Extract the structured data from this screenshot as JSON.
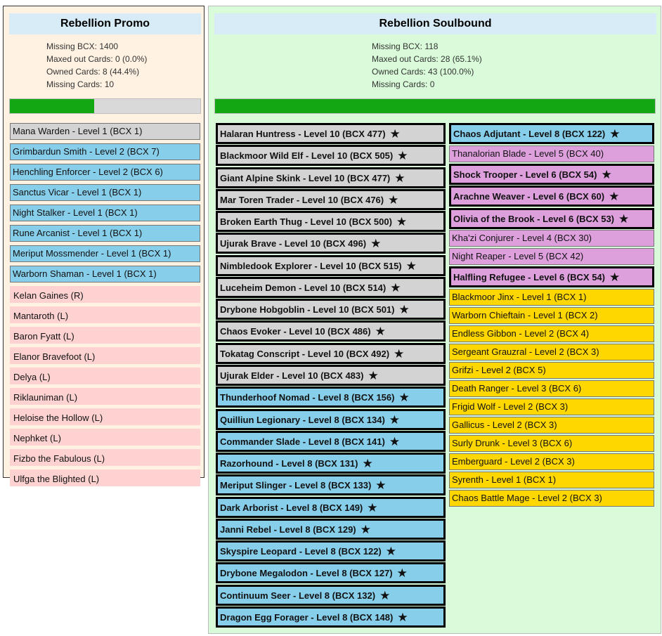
{
  "promo": {
    "title": "Rebellion Promo",
    "stats": [
      "Missing BCX: 1400",
      "Maxed out Cards: 0 (0.0%)",
      "Owned Cards: 8 (44.4%)",
      "Missing Cards: 10"
    ],
    "progress_fraction": 0.444,
    "cards": [
      {
        "label": "Mana Warden - Level 1 (BCX 1)",
        "color": "gray",
        "state": "owned"
      },
      {
        "label": "Grimbardun Smith - Level 2 (BCX 7)",
        "color": "blue",
        "state": "owned"
      },
      {
        "label": "Henchling Enforcer - Level 2 (BCX 6)",
        "color": "blue",
        "state": "owned"
      },
      {
        "label": "Sanctus Vicar - Level 1 (BCX 1)",
        "color": "blue",
        "state": "owned"
      },
      {
        "label": "Night Stalker - Level 1 (BCX 1)",
        "color": "blue",
        "state": "owned"
      },
      {
        "label": "Rune Arcanist - Level 1 (BCX 1)",
        "color": "blue",
        "state": "owned"
      },
      {
        "label": "Meriput Mossmender - Level 1 (BCX 1)",
        "color": "blue",
        "state": "owned"
      },
      {
        "label": "Warborn Shaman - Level 1 (BCX 1)",
        "color": "blue",
        "state": "owned"
      },
      {
        "label": "Kelan Gaines (R)",
        "color": "pink",
        "state": "missing"
      },
      {
        "label": "Mantaroth (L)",
        "color": "pink",
        "state": "missing"
      },
      {
        "label": "Baron Fyatt (L)",
        "color": "pink",
        "state": "missing"
      },
      {
        "label": "Elanor Bravefoot (L)",
        "color": "pink",
        "state": "missing"
      },
      {
        "label": "Delya (L)",
        "color": "pink",
        "state": "missing"
      },
      {
        "label": "Riklauniman (L)",
        "color": "pink",
        "state": "missing"
      },
      {
        "label": "Heloise the Hollow (L)",
        "color": "pink",
        "state": "missing"
      },
      {
        "label": "Nephket (L)",
        "color": "pink",
        "state": "missing"
      },
      {
        "label": "Fizbo the Fabulous (L)",
        "color": "pink",
        "state": "missing"
      },
      {
        "label": "Ulfga the Blighted (L)",
        "color": "pink",
        "state": "missing"
      }
    ]
  },
  "soulbound": {
    "title": "Rebellion Soulbound",
    "stats": [
      "Missing BCX: 118",
      "Maxed out Cards: 28 (65.1%)",
      "Owned Cards: 43 (100.0%)",
      "Missing Cards: 0"
    ],
    "progress_fraction": 1.0,
    "left_cards": [
      {
        "label": "Halaran Huntress - Level 10 (BCX 477)",
        "color": "gray",
        "maxed": true
      },
      {
        "label": "Blackmoor Wild Elf - Level 10 (BCX 505)",
        "color": "gray",
        "maxed": true
      },
      {
        "label": "Giant Alpine Skink - Level 10 (BCX 477)",
        "color": "gray",
        "maxed": true
      },
      {
        "label": "Mar Toren Trader - Level 10 (BCX 476)",
        "color": "gray",
        "maxed": true
      },
      {
        "label": "Broken Earth Thug - Level 10 (BCX 500)",
        "color": "gray",
        "maxed": true
      },
      {
        "label": "Ujurak Brave - Level 10 (BCX 496)",
        "color": "gray",
        "maxed": true
      },
      {
        "label": "Nimbledook Explorer - Level 10 (BCX 515)",
        "color": "gray",
        "maxed": true
      },
      {
        "label": "Luceheim Demon - Level 10 (BCX 514)",
        "color": "gray",
        "maxed": true
      },
      {
        "label": "Drybone Hobgoblin - Level 10 (BCX 501)",
        "color": "gray",
        "maxed": true
      },
      {
        "label": "Chaos Evoker - Level 10 (BCX 486)",
        "color": "gray",
        "maxed": true
      },
      {
        "label": "Tokatag Conscript - Level 10 (BCX 492)",
        "color": "gray",
        "maxed": true
      },
      {
        "label": "Ujurak Elder - Level 10 (BCX 483)",
        "color": "gray",
        "maxed": true
      },
      {
        "label": "Thunderhoof Nomad - Level 8 (BCX 156)",
        "color": "blue",
        "maxed": true
      },
      {
        "label": "Quilliun Legionary - Level 8 (BCX 134)",
        "color": "blue",
        "maxed": true
      },
      {
        "label": "Commander Slade - Level 8 (BCX 141)",
        "color": "blue",
        "maxed": true
      },
      {
        "label": "Razorhound - Level 8 (BCX 131)",
        "color": "blue",
        "maxed": true
      },
      {
        "label": "Meriput Slinger - Level 8 (BCX 133)",
        "color": "blue",
        "maxed": true
      },
      {
        "label": "Dark Arborist - Level 8 (BCX 149)",
        "color": "blue",
        "maxed": true
      },
      {
        "label": "Janni Rebel - Level 8 (BCX 129)",
        "color": "blue",
        "maxed": true
      },
      {
        "label": "Skyspire Leopard - Level 8 (BCX 122)",
        "color": "blue",
        "maxed": true
      },
      {
        "label": "Drybone Megalodon - Level 8 (BCX 127)",
        "color": "blue",
        "maxed": true
      },
      {
        "label": "Continuum Seer - Level 8 (BCX 132)",
        "color": "blue",
        "maxed": true
      },
      {
        "label": "Dragon Egg Forager - Level 8 (BCX 148)",
        "color": "blue",
        "maxed": true
      }
    ],
    "right_cards": [
      {
        "label": "Chaos Adjutant - Level 8 (BCX 122)",
        "color": "blue",
        "maxed": true
      },
      {
        "label": "Thanalorian Blade - Level 5 (BCX 40)",
        "color": "violet",
        "maxed": false
      },
      {
        "label": "Shock Trooper - Level 6 (BCX 54)",
        "color": "violet",
        "maxed": true
      },
      {
        "label": "Arachne Weaver - Level 6 (BCX 60)",
        "color": "violet",
        "maxed": true
      },
      {
        "label": "Olivia of the Brook - Level 6 (BCX 53)",
        "color": "violet",
        "maxed": true
      },
      {
        "label": "Kha'zi Conjurer - Level 4 (BCX 30)",
        "color": "violet",
        "maxed": false
      },
      {
        "label": "Night Reaper - Level 5 (BCX 42)",
        "color": "violet",
        "maxed": false
      },
      {
        "label": "Halfling Refugee - Level 6 (BCX 54)",
        "color": "violet",
        "maxed": true
      },
      {
        "label": "Blackmoor Jinx - Level 1 (BCX 1)",
        "color": "gold",
        "maxed": false
      },
      {
        "label": "Warborn Chieftain - Level 1 (BCX 2)",
        "color": "gold",
        "maxed": false
      },
      {
        "label": "Endless Gibbon - Level 2 (BCX 4)",
        "color": "gold",
        "maxed": false
      },
      {
        "label": "Sergeant Grauzral - Level 2 (BCX 3)",
        "color": "gold",
        "maxed": false
      },
      {
        "label": "Grifzi - Level 2 (BCX 5)",
        "color": "gold",
        "maxed": false
      },
      {
        "label": "Death Ranger - Level 3 (BCX 6)",
        "color": "gold",
        "maxed": false
      },
      {
        "label": "Frigid Wolf - Level 2 (BCX 3)",
        "color": "gold",
        "maxed": false
      },
      {
        "label": "Gallicus - Level 2 (BCX 3)",
        "color": "gold",
        "maxed": false
      },
      {
        "label": "Surly Drunk - Level 3 (BCX 6)",
        "color": "gold",
        "maxed": false
      },
      {
        "label": "Emberguard - Level 2 (BCX 3)",
        "color": "gold",
        "maxed": false
      },
      {
        "label": "Syrenth - Level 1 (BCX 1)",
        "color": "gold",
        "maxed": false
      },
      {
        "label": "Chaos Battle Mage - Level 2 (BCX 3)",
        "color": "gold",
        "maxed": false
      }
    ]
  },
  "icons": {
    "maxed_star": "star-icon",
    "star_glyph": "★"
  },
  "colors": {
    "progress": "#13a713",
    "gray": "#d3d3d3",
    "blue": "#87ceeb",
    "pink": "#ffd2d2",
    "violet": "#dda0dd",
    "gold": "#ffd700"
  }
}
